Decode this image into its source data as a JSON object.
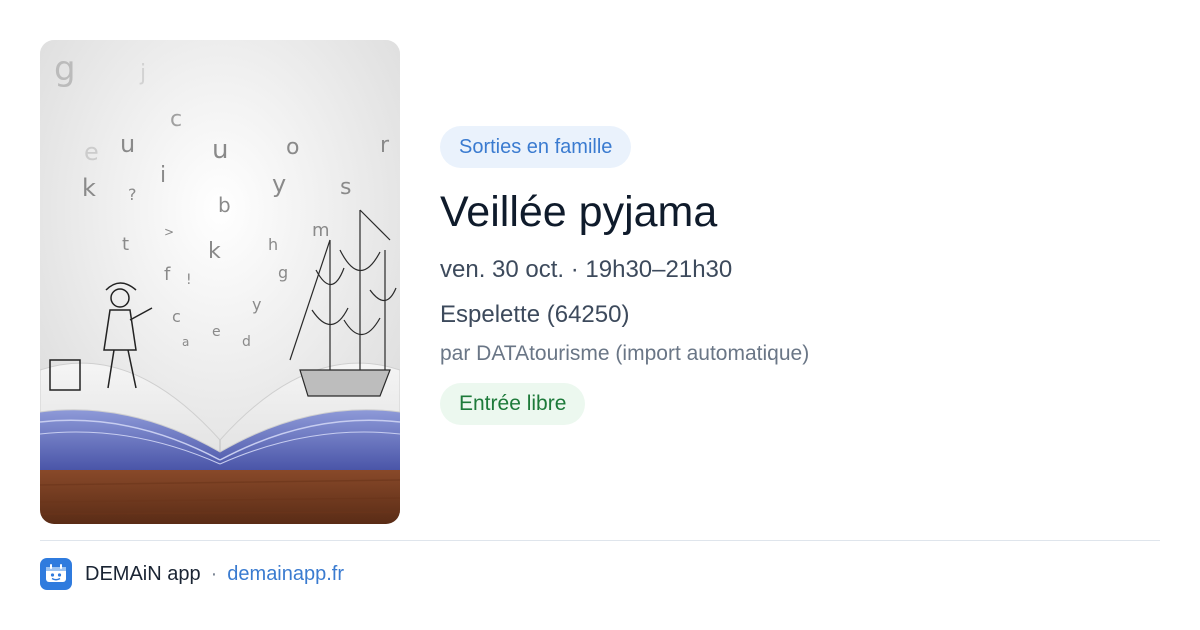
{
  "event": {
    "category": "Sorties en famille",
    "title": "Veillée pyjama",
    "datetime": "ven. 30 oct. · 19h30–21h30",
    "location": "Espelette (64250)",
    "organizer": "par DATAtourisme (import automatique)",
    "price": "Entrée libre"
  },
  "image": {
    "icon": "open-book-illustration",
    "letters": [
      "g",
      "j",
      "c",
      "u",
      "e",
      "u",
      "o",
      "r",
      "k",
      "i",
      "?",
      "y",
      "s",
      "t",
      "b",
      "k",
      "m",
      "h",
      "f",
      "!",
      "g",
      "y",
      "c",
      "e",
      "d",
      "a",
      ">"
    ]
  },
  "footer": {
    "app_name": "DEMAiN app",
    "separator": "·",
    "link": "demainapp.fr",
    "icon": "demain-app-logo-icon"
  },
  "colors": {
    "accent": "#3a7bd0",
    "category_chip_bg": "#eaf2fc",
    "price_chip_bg": "#ecf8ef",
    "price_chip_text": "#1d7a3a",
    "title_text": "#0f1b2b"
  }
}
